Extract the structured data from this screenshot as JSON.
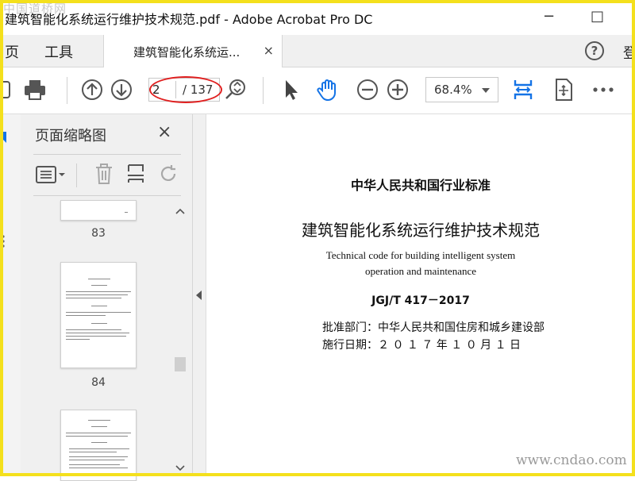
{
  "watermark_top": "中国道桥网",
  "watermark_bottom": "www.cndao.com",
  "window": {
    "title": "建筑智能化系统运行维护技术规范.pdf - Adobe Acrobat Pro DC",
    "minimize": "−",
    "maximize": "□"
  },
  "menubar": {
    "home": "页",
    "tools": "工具",
    "tab_label": "建筑智能化系统运...",
    "tab_close": "×",
    "help": "?",
    "signin": "登"
  },
  "toolbar": {
    "current_page": "2",
    "total_pages": "/ 137",
    "zoom": "68.4%"
  },
  "thumbnail_panel": {
    "title": "页面缩略图",
    "close": "×",
    "pages": [
      {
        "number": "83"
      },
      {
        "number": "84"
      }
    ]
  },
  "document": {
    "issuer": "中华人民共和国行业标准",
    "title_cn": "建筑智能化系统运行维护技术规范",
    "title_en_line1": "Technical code for building intelligent system",
    "title_en_line2": "operation and maintenance",
    "code": "JGJ/T 417－2017",
    "approval_label": "批准部门：",
    "approval_value": "中华人民共和国住房和城乡建设部",
    "effective_label": "施行日期：",
    "effective_value": "２ ０ １ ７  年  １ ０  月  １  日"
  },
  "colors": {
    "accent": "#1473e6",
    "frame": "#f4e01c",
    "highlight": "#e02020"
  }
}
